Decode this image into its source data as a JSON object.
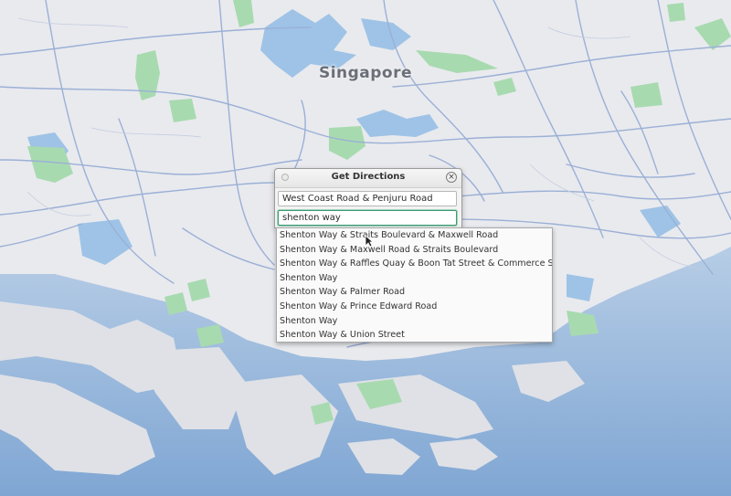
{
  "map": {
    "city_label": "Singapore",
    "colors": {
      "land": "#e9eaee",
      "water": "#9ec3e6",
      "sea": "#8fb3d9",
      "park": "#a8dab0",
      "road": "#9bb0d6"
    }
  },
  "dialog": {
    "title": "Get Directions",
    "close_icon": "close-icon",
    "from_value": "West Coast Road & Penjuru Road",
    "to_value": "shenton way"
  },
  "suggestions": [
    "Shenton Way & Straits Boulevard & Maxwell Road",
    "Shenton Way & Maxwell Road & Straits Boulevard",
    "Shenton Way & Raffles Quay & Boon Tat Street & Commerce Street",
    "Shenton Way",
    "Shenton Way & Palmer Road",
    "Shenton Way & Prince Edward Road",
    "Shenton Way",
    "Shenton Way & Union Street"
  ]
}
